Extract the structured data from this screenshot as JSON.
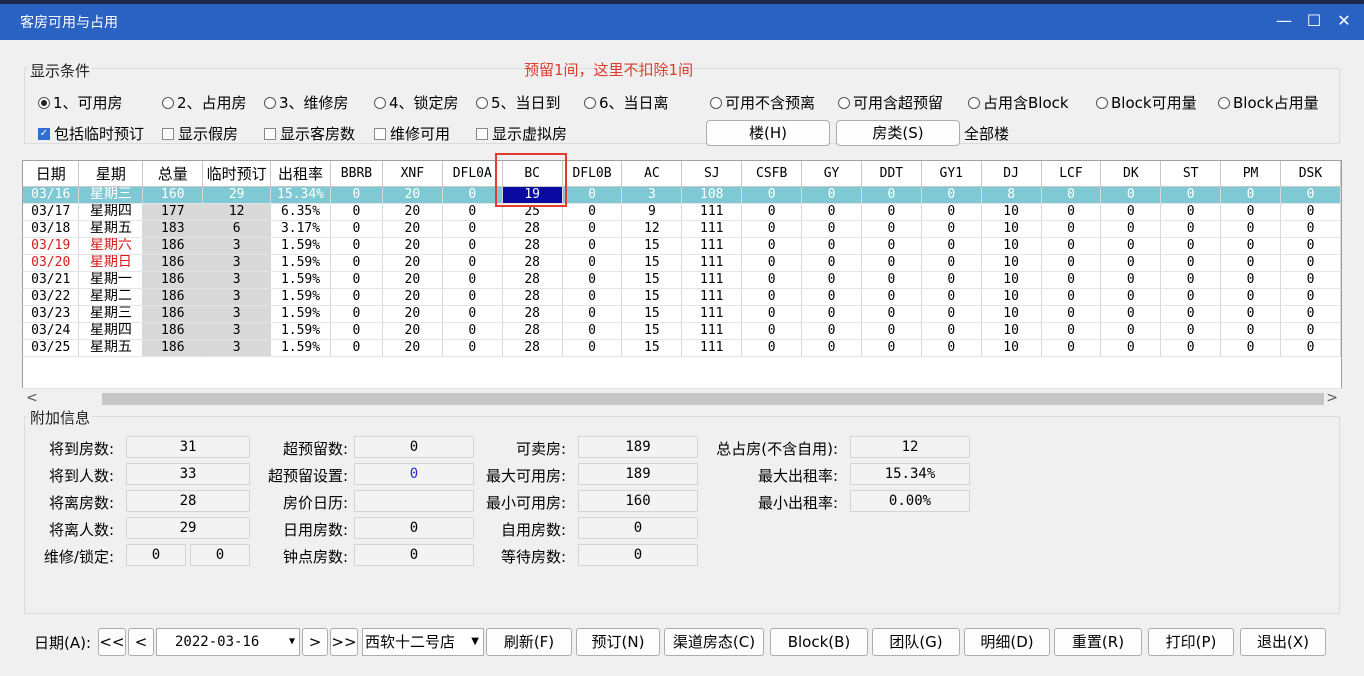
{
  "window": {
    "title": "客房可用与占用",
    "minimize": "—",
    "maximize": "☐",
    "close": "✕"
  },
  "conditions": {
    "legend": "显示条件",
    "annotation": "预留1间，这里不扣除1间",
    "radios": [
      {
        "label": "1、可用房",
        "checked": true
      },
      {
        "label": "2、占用房",
        "checked": false
      },
      {
        "label": "3、维修房",
        "checked": false
      },
      {
        "label": "4、锁定房",
        "checked": false
      },
      {
        "label": "5、当日到",
        "checked": false
      },
      {
        "label": "6、当日离",
        "checked": false
      },
      {
        "label": "可用不含预离",
        "checked": false
      },
      {
        "label": "可用含超预留",
        "checked": false
      },
      {
        "label": "占用含Block",
        "checked": false
      },
      {
        "label": "Block可用量",
        "checked": false
      },
      {
        "label": "Block占用量",
        "checked": false
      }
    ],
    "checks": [
      {
        "label": "包括临时预订",
        "checked": true
      },
      {
        "label": "显示假房",
        "checked": false
      },
      {
        "label": "显示客房数",
        "checked": false
      },
      {
        "label": "维修可用",
        "checked": false
      },
      {
        "label": "显示虚拟房",
        "checked": false
      }
    ],
    "building_button": "楼(H)",
    "roomtype_button": "房类(S)",
    "all_buildings": "全部楼"
  },
  "grid": {
    "columns": [
      "日期",
      "星期",
      "总量",
      "临时预订",
      "出租率",
      "BBRB",
      "XNF",
      "DFL0A",
      "BC",
      "DFL0B",
      "AC",
      "SJ",
      "CSFB",
      "GY",
      "DDT",
      "GY1",
      "DJ",
      "LCF",
      "DK",
      "ST",
      "PM",
      "DSK"
    ],
    "rows": [
      [
        "03/16",
        "星期三",
        "160",
        "29",
        "15.34%",
        "0",
        "20",
        "0",
        "19",
        "0",
        "3",
        "108",
        "0",
        "0",
        "0",
        "0",
        "8",
        "0",
        "0",
        "0",
        "0",
        "0"
      ],
      [
        "03/17",
        "星期四",
        "177",
        "12",
        "6.35%",
        "0",
        "20",
        "0",
        "25",
        "0",
        "9",
        "111",
        "0",
        "0",
        "0",
        "0",
        "10",
        "0",
        "0",
        "0",
        "0",
        "0"
      ],
      [
        "03/18",
        "星期五",
        "183",
        "6",
        "3.17%",
        "0",
        "20",
        "0",
        "28",
        "0",
        "12",
        "111",
        "0",
        "0",
        "0",
        "0",
        "10",
        "0",
        "0",
        "0",
        "0",
        "0"
      ],
      [
        "03/19",
        "星期六",
        "186",
        "3",
        "1.59%",
        "0",
        "20",
        "0",
        "28",
        "0",
        "15",
        "111",
        "0",
        "0",
        "0",
        "0",
        "10",
        "0",
        "0",
        "0",
        "0",
        "0"
      ],
      [
        "03/20",
        "星期日",
        "186",
        "3",
        "1.59%",
        "0",
        "20",
        "0",
        "28",
        "0",
        "15",
        "111",
        "0",
        "0",
        "0",
        "0",
        "10",
        "0",
        "0",
        "0",
        "0",
        "0"
      ],
      [
        "03/21",
        "星期一",
        "186",
        "3",
        "1.59%",
        "0",
        "20",
        "0",
        "28",
        "0",
        "15",
        "111",
        "0",
        "0",
        "0",
        "0",
        "10",
        "0",
        "0",
        "0",
        "0",
        "0"
      ],
      [
        "03/22",
        "星期二",
        "186",
        "3",
        "1.59%",
        "0",
        "20",
        "0",
        "28",
        "0",
        "15",
        "111",
        "0",
        "0",
        "0",
        "0",
        "10",
        "0",
        "0",
        "0",
        "0",
        "0"
      ],
      [
        "03/23",
        "星期三",
        "186",
        "3",
        "1.59%",
        "0",
        "20",
        "0",
        "28",
        "0",
        "15",
        "111",
        "0",
        "0",
        "0",
        "0",
        "10",
        "0",
        "0",
        "0",
        "0",
        "0"
      ],
      [
        "03/24",
        "星期四",
        "186",
        "3",
        "1.59%",
        "0",
        "20",
        "0",
        "28",
        "0",
        "15",
        "111",
        "0",
        "0",
        "0",
        "0",
        "10",
        "0",
        "0",
        "0",
        "0",
        "0"
      ],
      [
        "03/25",
        "星期五",
        "186",
        "3",
        "1.59%",
        "0",
        "20",
        "0",
        "28",
        "0",
        "15",
        "111",
        "0",
        "0",
        "0",
        "0",
        "10",
        "0",
        "0",
        "0",
        "0",
        "0"
      ]
    ],
    "weekend_rows": [
      3,
      4
    ],
    "selected_row": 0,
    "highlight_col": 8,
    "scroll_left": "<",
    "scroll_right": ">"
  },
  "info": {
    "legend": "附加信息",
    "c1": [
      {
        "label": "将到房数:",
        "value": "31"
      },
      {
        "label": "将到人数:",
        "value": "33"
      },
      {
        "label": "将离房数:",
        "value": "28"
      },
      {
        "label": "将离人数:",
        "value": "29"
      }
    ],
    "maint_lock_label": "维修/锁定:",
    "maint_value": "0",
    "lock_value": "0",
    "c2": [
      {
        "label": "超预留数:",
        "value": "0"
      },
      {
        "label": "超预留设置:",
        "value": "0"
      },
      {
        "label": "房价日历:",
        "value": ""
      },
      {
        "label": "日用房数:",
        "value": "0"
      },
      {
        "label": "钟点房数:",
        "value": "0"
      }
    ],
    "c3": [
      {
        "label": "可卖房:",
        "value": "189"
      },
      {
        "label": "最大可用房:",
        "value": "189"
      },
      {
        "label": "最小可用房:",
        "value": "160"
      },
      {
        "label": "自用房数:",
        "value": "0"
      },
      {
        "label": "等待房数:",
        "value": "0"
      }
    ],
    "c4": [
      {
        "label": "总占房(不含自用):",
        "value": "12"
      },
      {
        "label": "最大出租率:",
        "value": "15.34%"
      },
      {
        "label": "最小出租率:",
        "value": "0.00%"
      }
    ]
  },
  "bottom": {
    "date_label": "日期(A):",
    "first": "<<",
    "prev": "<",
    "date_value": "2022-03-16",
    "next": ">",
    "last": ">>",
    "hotel": "西软十二号店",
    "buttons": [
      "刷新(F)",
      "预订(N)",
      "渠道房态(C)",
      "Block(B)",
      "团队(G)",
      "明细(D)",
      "重置(R)",
      "打印(P)",
      "退出(X)"
    ]
  }
}
